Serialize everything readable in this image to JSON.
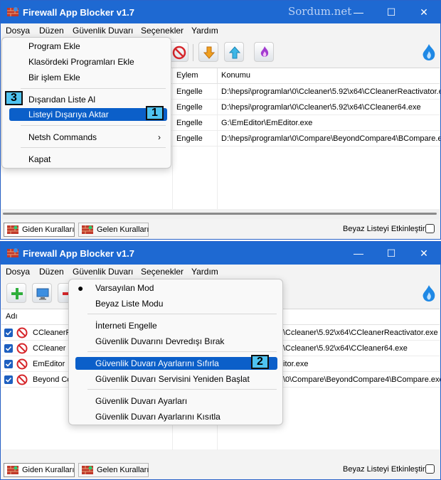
{
  "app": {
    "title": "Firewall App Blocker v1.7",
    "watermark": "Sordum.net",
    "window_buttons": {
      "minimize": "—",
      "maximize": "☐",
      "close": "✕"
    }
  },
  "menubar": [
    "Dosya",
    "Düzen",
    "Güvenlik Duvarı",
    "Seçenekler",
    "Yardım"
  ],
  "list": {
    "headers": {
      "name": "Adı",
      "action": "Eylem",
      "location": "Konumu"
    },
    "rows": [
      {
        "name": "CCleanerReactivator",
        "action": "Engelle",
        "location": "D:\\hepsi\\programlar\\0\\Ccleaner\\5.92\\x64\\CCleanerReactivator.exe"
      },
      {
        "name": "CCleaner",
        "action": "Engelle",
        "location": "D:\\hepsi\\programlar\\0\\Ccleaner\\5.92\\x64\\CCleaner64.exe"
      },
      {
        "name": "EmEditor",
        "action": "Engelle",
        "location": "G:\\EmEditor\\EmEditor.exe"
      },
      {
        "name": "Beyond Compare",
        "action": "Engelle",
        "location": "D:\\hepsi\\programlar\\0\\Compare\\BeyondCompare4\\BCompare.exe"
      }
    ]
  },
  "window2_visible": {
    "names": [
      "CCleanerR",
      "CCleaner",
      "EmEditor",
      "Beyond Co"
    ],
    "locations": [
      "\\Ccleaner\\5.92\\x64\\CCleanerReactivator.exe",
      "\\Ccleaner\\5.92\\x64\\CCleaner64.exe",
      "itor.exe",
      "\\0\\Compare\\BeyondCompare4\\BCompare.exe"
    ]
  },
  "bottom": {
    "tab_outgoing": "Giden Kuralları",
    "tab_incoming": "Gelen Kuralları",
    "whitelist_label": "Beyaz Listeyi Etkinleştir"
  },
  "file_menu": {
    "items": [
      "Program Ekle",
      "Klasördeki Programları Ekle",
      "Bir işlem Ekle",
      "Dışarıdan Liste Al",
      "Listeyi Dışarıya Aktar",
      "Netsh Commands",
      "Kapat"
    ],
    "submenu_arrow": "›",
    "highlighted": "Listeyi Dışarıya Aktar"
  },
  "firewall_menu": {
    "items": [
      "Varsayılan Mod",
      "Beyaz Liste Modu",
      "İnterneti Engelle",
      "Güvenlik Duvarını Devredışı Bırak",
      "Güvenlik Duvarı Ayarlarını Sıfırla",
      "Güvenlik Duvarı Servisini Yeniden Başlat",
      "Güvenlik Duvarı Ayarları",
      "Güvenlik Duvarı Ayarlarını Kısıtla"
    ],
    "selected_bullet": "●",
    "highlighted": "Güvenlik Duvarı Ayarlarını Sıfırla"
  },
  "badges": {
    "b1": "1",
    "b2": "2",
    "b3": "3"
  },
  "colors": {
    "titlebar": "#1e69d2",
    "highlight": "#0b5fc9",
    "badge": "#4fc3f0"
  }
}
